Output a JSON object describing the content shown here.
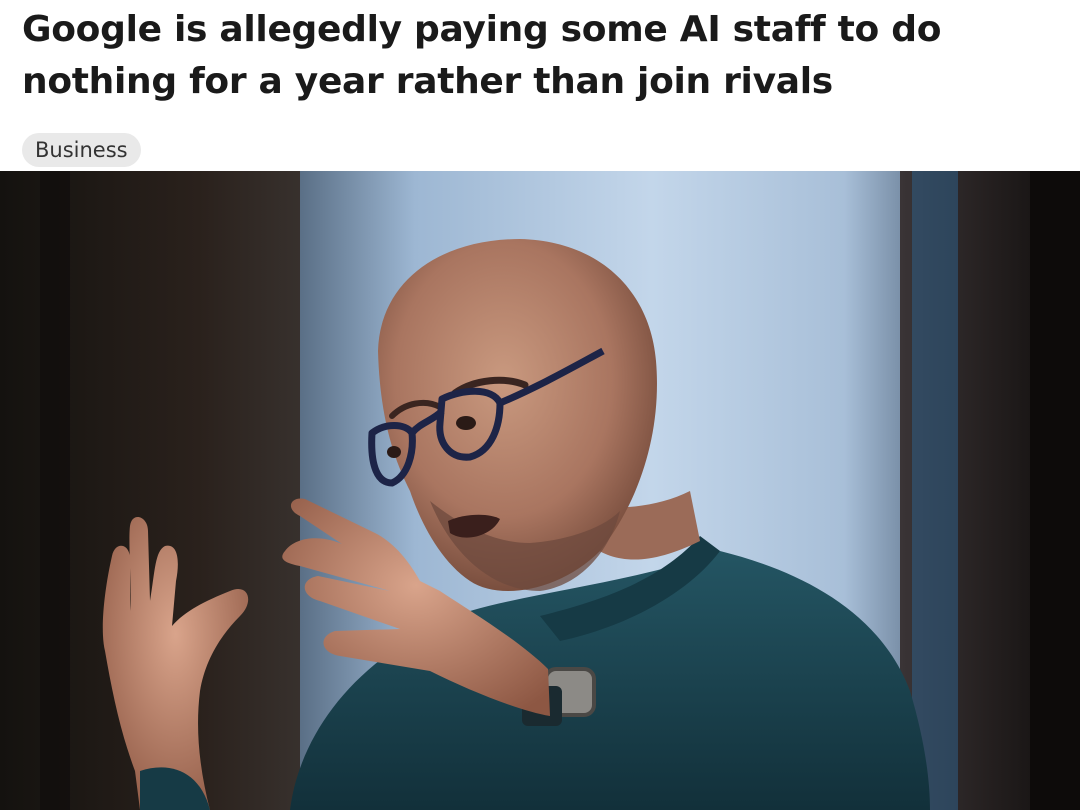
{
  "article": {
    "headline": "Google is allegedly paying some AI staff to do nothing for a year rather than join rivals",
    "category": "Business"
  },
  "hero_image": {
    "subject": "bald man with dark-rimmed glasses and teal sweater gesturing with both hands while speaking"
  },
  "colors": {
    "headline": "#1a1a1a",
    "tag_background": "#e9e9e9",
    "tag_text": "#333333",
    "sweater": "#1f4a57",
    "backdrop_window": "#a9c4e0"
  }
}
